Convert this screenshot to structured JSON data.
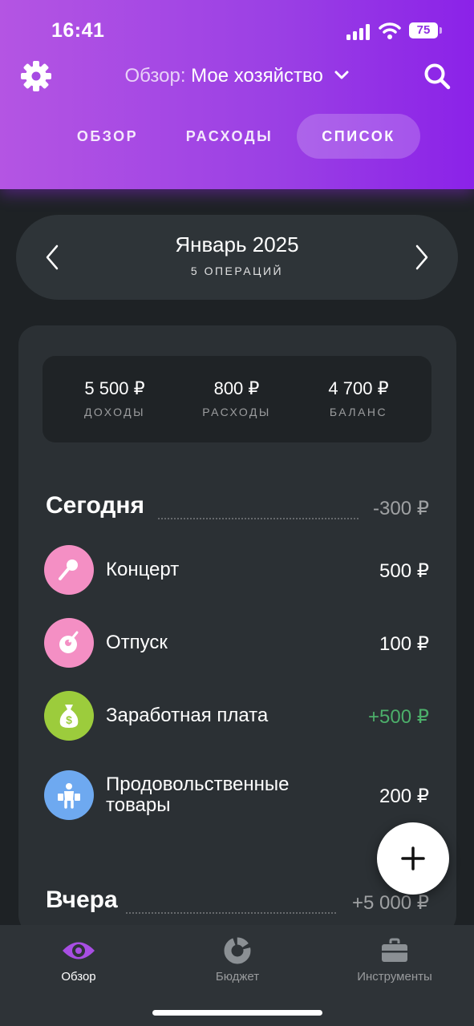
{
  "status_bar": {
    "time": "16:41",
    "battery": "75"
  },
  "header": {
    "title_prefix": "Обзор:",
    "title_main": "Мое хозяйство",
    "tabs": [
      {
        "label": "ОБЗОР",
        "active": false
      },
      {
        "label": "РАСХОДЫ",
        "active": false
      },
      {
        "label": "СПИСОК",
        "active": true
      }
    ]
  },
  "month": {
    "title": "Январь 2025",
    "subtitle": "5 ОПЕРАЦИЙ"
  },
  "summary": [
    {
      "value": "5 500 ₽",
      "label": "ДОХОДЫ"
    },
    {
      "value": "800 ₽",
      "label": "РАСХОДЫ"
    },
    {
      "value": "4 700 ₽",
      "label": "БАЛАНС"
    }
  ],
  "days": [
    {
      "title": "Сегодня",
      "total": "-300 ₽",
      "transactions": [
        {
          "name": "Концерт",
          "amount": "500 ₽",
          "icon": "microphone-icon",
          "color": "#f48fc4",
          "income": false
        },
        {
          "name": "Отпуск",
          "amount": "100 ₽",
          "icon": "coconut-icon",
          "color": "#f48fc4",
          "income": false
        },
        {
          "name": "Заработная плата",
          "amount": "+500 ₽",
          "icon": "money-bag-icon",
          "color": "#9ccc3c",
          "income": true
        },
        {
          "name": "Продовольственные товары",
          "name_line1": "Продовольственные",
          "name_line2": "товары",
          "amount": "200 ₽",
          "icon": "grocery-person-icon",
          "color": "#6ea9f0",
          "income": false
        }
      ]
    },
    {
      "title": "Вчера",
      "total": "+5 000 ₽"
    }
  ],
  "bottom_nav": [
    {
      "label": "Обзор",
      "icon": "eye-icon",
      "active": true
    },
    {
      "label": "Бюджет",
      "icon": "donut-chart-icon",
      "active": false
    },
    {
      "label": "Инструменты",
      "icon": "briefcase-icon",
      "active": false
    }
  ],
  "colors": {
    "accent": "#9a3fe4",
    "income": "#4caf6a",
    "background": "#1e2225"
  }
}
